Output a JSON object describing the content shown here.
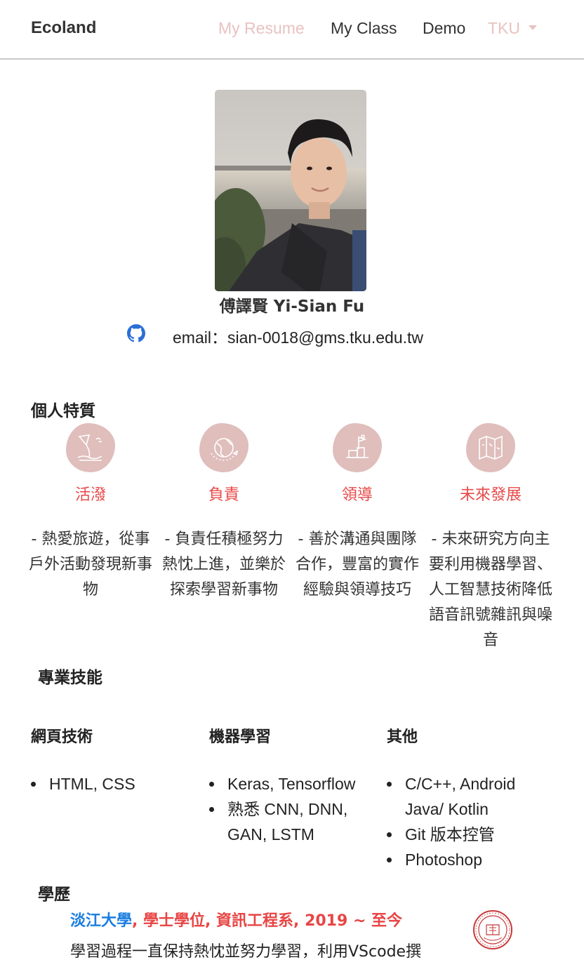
{
  "nav": {
    "brand": "Ecoland",
    "links": [
      {
        "label": "My Resume",
        "active": true
      },
      {
        "label": "My Class",
        "active": false
      },
      {
        "label": "Demo",
        "active": false
      },
      {
        "label": "TKU",
        "active": true,
        "dropdown": true
      }
    ]
  },
  "profile": {
    "name": "傅譯賢 Yi-Sian Fu",
    "email": "email：sian-0018@gms.tku.edu.tw",
    "github_icon": "github-icon"
  },
  "traits": {
    "title": "個人特質",
    "items": [
      {
        "icon": "kite-beach-icon",
        "title": "活潑",
        "desc": "- 熱愛旅遊，從事戶外活動發現新事物"
      },
      {
        "icon": "globe-plane-icon",
        "title": "負責",
        "desc": "- 負責任積極努力熱忱上進，並樂於探索學習新事物"
      },
      {
        "icon": "summit-flag-icon",
        "title": "領導",
        "desc": "- 善於溝通與團隊合作，豐富的實作經驗與領導技巧"
      },
      {
        "icon": "map-icon",
        "title": "未來發展",
        "desc": "- 未來研究方向主要利用機器學習、人工智慧技術降低語音訊號雜訊與噪音"
      }
    ]
  },
  "skills": {
    "title": "專業技能",
    "columns": [
      {
        "heading": "網頁技術",
        "items": [
          "HTML, CSS"
        ]
      },
      {
        "heading": "機器學習",
        "items": [
          "Keras, Tensorflow",
          "熟悉 CNN, DNN, GAN, LSTM"
        ]
      },
      {
        "heading": "其他",
        "items": [
          "C/C++, Android Java/ Kotlin",
          "Git 版本控管",
          "Photoshop"
        ]
      }
    ]
  },
  "education": {
    "title": "學歷",
    "school": "淡江大學",
    "detail": ", 學士學位, 資訊工程系, 2019 ~ 至今",
    "desc": "學習過程一直保持熱忱並努力學習，利用VScode撰"
  },
  "colors": {
    "accent_pink": "#e8c3c1",
    "trait_title_red": "#e84a4a",
    "school_blue": "#1a7de0",
    "github_blue": "#2b6fd6"
  }
}
